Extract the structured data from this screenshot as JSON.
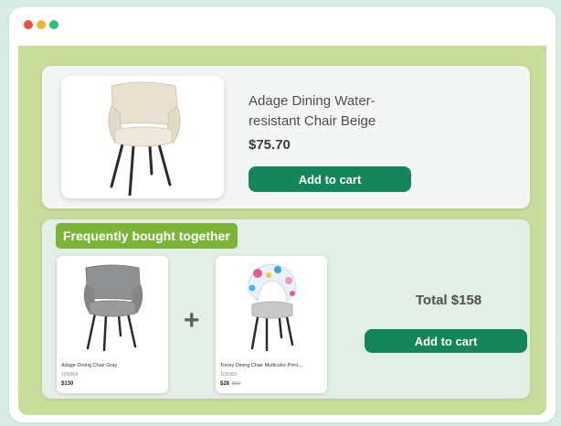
{
  "colors": {
    "dot_red": "#e5533d",
    "dot_yellow": "#f4b43a",
    "dot_green": "#2ec46d",
    "accent_green": "#14865a",
    "badge_green": "#7cb43a"
  },
  "product": {
    "title": "Adage Dining Water-resistant Chair Beige",
    "price": "$75.70",
    "add_label": "Add to cart"
  },
  "bundle": {
    "heading": "Frequently bought together",
    "plus": "+",
    "total": "Total $158",
    "add_label": "Add to cart",
    "items": [
      {
        "name": "Adage Dining Chair Gray",
        "sku": "109364",
        "price": "$130",
        "old_price": ""
      },
      {
        "name": "Torrey Dining Chair Multicolor Print...",
        "sku": "109365",
        "price": "$28",
        "old_price": "$56"
      }
    ]
  }
}
